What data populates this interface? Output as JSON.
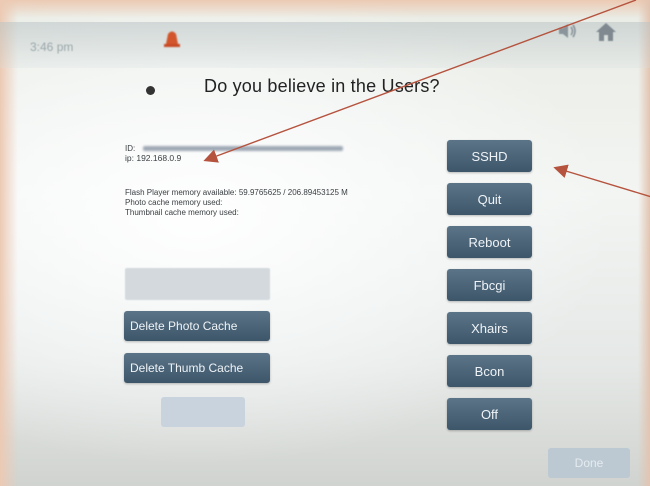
{
  "status_bar": {
    "time": "3:46 pm"
  },
  "dialog": {
    "title": "Do you believe in the Users?",
    "id_label": "ID:",
    "ip_text": "ip: 192.168.0.9",
    "flash_memory_text": "Flash Player memory available: 59.9765625 / 206.89453125 M",
    "photo_cache_text": "Photo cache memory used:",
    "thumb_cache_text": "Thumbnail cache memory used:"
  },
  "left_buttons": {
    "delete_photo": "Delete Photo Cache",
    "delete_thumb": "Delete Thumb Cache"
  },
  "right_buttons": {
    "sshd": "SSHD",
    "quit": "Quit",
    "reboot": "Reboot",
    "fbcgi": "Fbcgi",
    "xhairs": "Xhairs",
    "bcon": "Bcon",
    "off": "Off"
  },
  "footer": {
    "done": "Done"
  },
  "colors": {
    "button": "#4a6378",
    "annotation_arrow": "#b5533e",
    "alert": "#d2552b"
  },
  "icons": [
    "bell-icon",
    "speaker-icon",
    "home-icon",
    "dot-icon"
  ]
}
